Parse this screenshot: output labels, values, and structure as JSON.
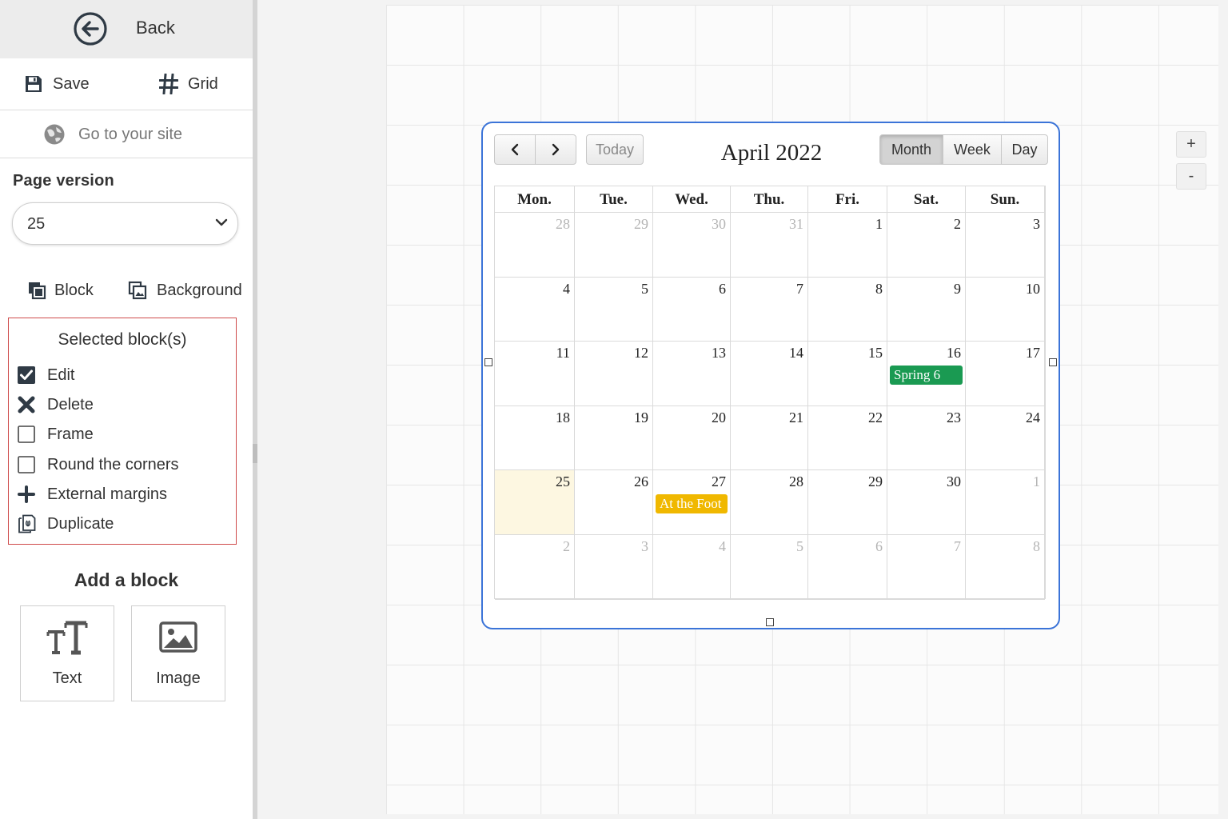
{
  "sidebar": {
    "back_label": "Back",
    "save_label": "Save",
    "grid_label": "Grid",
    "goto_site_label": "Go to your site",
    "page_version": {
      "label": "Page version",
      "value": "25"
    },
    "tabs": {
      "block_label": "Block",
      "background_label": "Background"
    },
    "selected_blocks": {
      "title": "Selected block(s)",
      "options": [
        {
          "label": "Edit",
          "icon": "checkbox-checked-icon",
          "checked": true
        },
        {
          "label": "Delete",
          "icon": "x-icon"
        },
        {
          "label": "Frame",
          "icon": "checkbox-empty-icon",
          "checked": false
        },
        {
          "label": "Round the corners",
          "icon": "checkbox-empty-icon",
          "checked": false
        },
        {
          "label": "External margins",
          "icon": "plus-icon"
        },
        {
          "label": "Duplicate",
          "icon": "duplicate-icon"
        }
      ]
    },
    "add_block": {
      "title": "Add a block",
      "text_label": "Text",
      "image_label": "Image"
    }
  },
  "canvas": {
    "zoom_in": "+",
    "zoom_out": "-"
  },
  "calendar": {
    "title": "April 2022",
    "prev_icon": "chevron-left-icon",
    "next_icon": "chevron-right-icon",
    "today_label": "Today",
    "views": [
      {
        "label": "Month",
        "active": true
      },
      {
        "label": "Week",
        "active": false
      },
      {
        "label": "Day",
        "active": false
      }
    ],
    "weekdays": [
      "Mon.",
      "Tue.",
      "Wed.",
      "Thu.",
      "Fri.",
      "Sat.",
      "Sun."
    ],
    "weeks": [
      [
        {
          "d": "28",
          "other": true
        },
        {
          "d": "29",
          "other": true
        },
        {
          "d": "30",
          "other": true
        },
        {
          "d": "31",
          "other": true
        },
        {
          "d": "1"
        },
        {
          "d": "2"
        },
        {
          "d": "3"
        }
      ],
      [
        {
          "d": "4"
        },
        {
          "d": "5"
        },
        {
          "d": "6"
        },
        {
          "d": "7"
        },
        {
          "d": "8"
        },
        {
          "d": "9"
        },
        {
          "d": "10"
        }
      ],
      [
        {
          "d": "11"
        },
        {
          "d": "12"
        },
        {
          "d": "13"
        },
        {
          "d": "14"
        },
        {
          "d": "15"
        },
        {
          "d": "16"
        },
        {
          "d": "17"
        }
      ],
      [
        {
          "d": "18"
        },
        {
          "d": "19"
        },
        {
          "d": "20"
        },
        {
          "d": "21"
        },
        {
          "d": "22"
        },
        {
          "d": "23"
        },
        {
          "d": "24"
        }
      ],
      [
        {
          "d": "25",
          "today": true
        },
        {
          "d": "26"
        },
        {
          "d": "27"
        },
        {
          "d": "28"
        },
        {
          "d": "29"
        },
        {
          "d": "30"
        },
        {
          "d": "1",
          "other": true
        }
      ],
      [
        {
          "d": "2",
          "other": true
        },
        {
          "d": "3",
          "other": true
        },
        {
          "d": "4",
          "other": true
        },
        {
          "d": "5",
          "other": true
        },
        {
          "d": "6",
          "other": true
        },
        {
          "d": "7",
          "other": true
        },
        {
          "d": "8",
          "other": true
        }
      ]
    ],
    "events": [
      {
        "title": "Spring 6",
        "week": 2,
        "day": 5,
        "color": "#1a9a52"
      },
      {
        "title": "At the Foot",
        "week": 4,
        "day": 2,
        "color": "#f0b800"
      }
    ]
  }
}
